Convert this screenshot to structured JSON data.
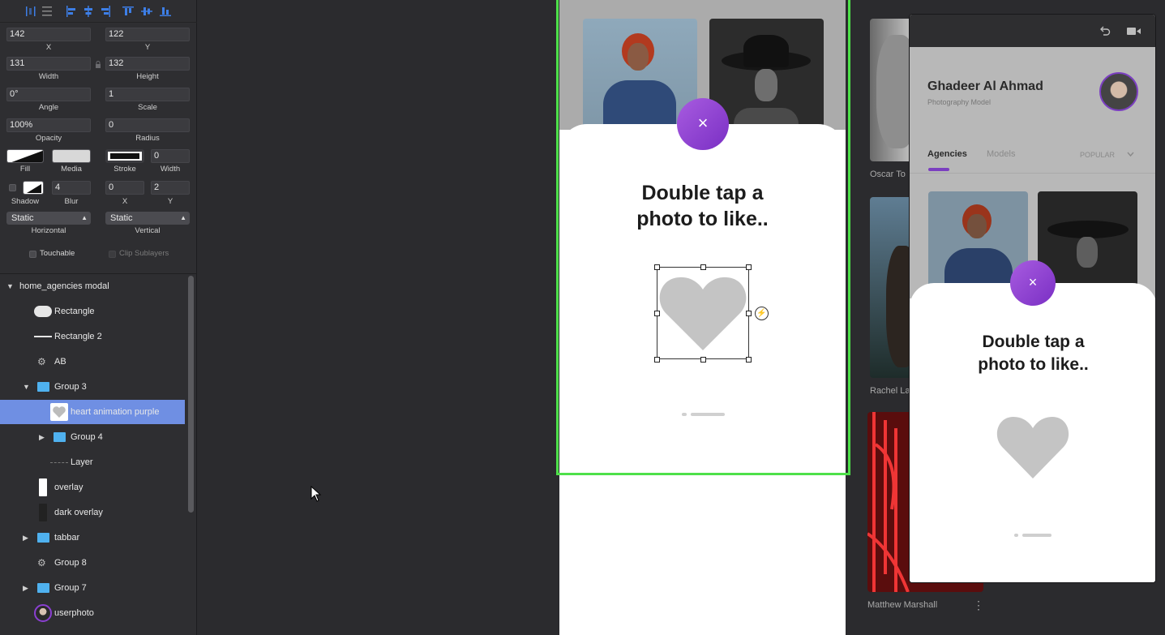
{
  "inspector": {
    "x": {
      "value": "142",
      "label": "X"
    },
    "y": {
      "value": "122",
      "label": "Y"
    },
    "width": {
      "value": "131",
      "label": "Width"
    },
    "height": {
      "value": "132",
      "label": "Height"
    },
    "angle": {
      "value": "0°",
      "label": "Angle"
    },
    "scale": {
      "value": "1",
      "label": "Scale"
    },
    "opacity": {
      "value": "100%",
      "label": "Opacity"
    },
    "radius": {
      "value": "0",
      "label": "Radius"
    },
    "fill_label": "Fill",
    "media_label": "Media",
    "stroke_label": "Stroke",
    "stroke_width": {
      "value": "0",
      "label": "Width"
    },
    "shadow_label": "Shadow",
    "blur": {
      "value": "4",
      "label": "Blur"
    },
    "shadow_x": {
      "value": "0",
      "label": "X"
    },
    "shadow_y": {
      "value": "2",
      "label": "Y"
    },
    "horizontal": {
      "value": "Static",
      "label": "Horizontal"
    },
    "vertical": {
      "value": "Static",
      "label": "Vertical"
    },
    "touchable_label": "Touchable",
    "clip_sublayers_label": "Clip Sublayers"
  },
  "layers": [
    {
      "label": "home_agencies modal",
      "icon": "triangle-down"
    },
    {
      "label": "Rectangle",
      "icon": "rounded-rect"
    },
    {
      "label": "Rectangle 2",
      "icon": "line"
    },
    {
      "label": "AB",
      "icon": "gear"
    },
    {
      "label": "Group 3",
      "icon": "folder"
    },
    {
      "label": "heart animation purple",
      "icon": "heart-thumb",
      "selected": true
    },
    {
      "label": "Group 4",
      "icon": "folder"
    },
    {
      "label": "Layer",
      "icon": "dashed-line"
    },
    {
      "label": "overlay",
      "icon": "white-rect"
    },
    {
      "label": "dark overlay",
      "icon": "dark-rect"
    },
    {
      "label": "tabbar",
      "icon": "folder"
    },
    {
      "label": "Group 8",
      "icon": "gear"
    },
    {
      "label": "Group 7",
      "icon": "folder"
    },
    {
      "label": "userphoto",
      "icon": "avatar"
    }
  ],
  "artboard": {
    "close_symbol": "×",
    "headline_line1": "Double tap a",
    "headline_line2": "photo to like..",
    "bolt_symbol": "⚡"
  },
  "background_cards": {
    "oscar_label": "Oscar To",
    "rachel_label": "Rachel La",
    "matthew_label": "Matthew Marshall",
    "more_symbol": "⋮"
  },
  "preview": {
    "profile_name": "Ghadeer Al Ahmad",
    "profile_subtitle": "Photography Model",
    "tabs": [
      "Agencies",
      "Models"
    ],
    "sort_label": "POPULAR",
    "close_symbol": "×",
    "headline_line1": "Double tap a",
    "headline_line2": "photo to like..",
    "undo_icon": "undo-icon",
    "camera_icon": "video-icon"
  },
  "colors": {
    "accent_purple": "#8a3fd1",
    "selection_green": "#4ee04a",
    "layer_selected": "#6f8fe3"
  }
}
